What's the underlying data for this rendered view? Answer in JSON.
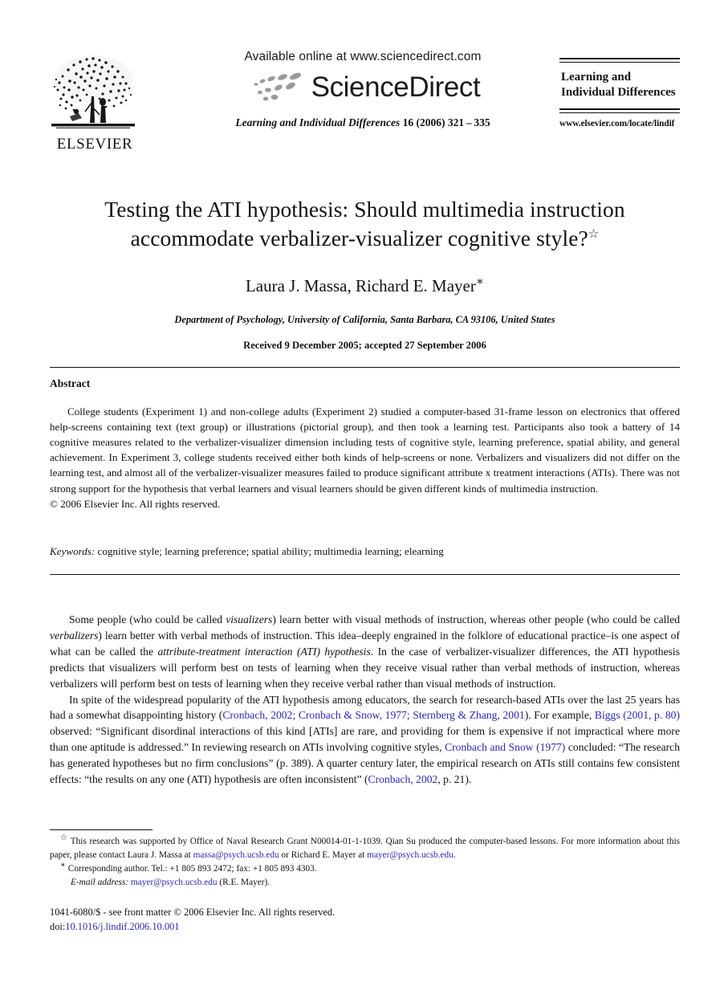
{
  "masthead": {
    "publisher_name": "ELSEVIER",
    "available_online": "Available online at www.sciencedirect.com",
    "sciencedirect_wordmark": "ScienceDirect",
    "journal_citation_italic": "Learning and Individual Differences",
    "journal_citation_rest": " 16 (2006) 321 – 335",
    "journal_logo_line1": "Learning and",
    "journal_logo_line2": "Individual Differences",
    "journal_url": "www.elsevier.com/locate/lindif"
  },
  "title": {
    "line1": "Testing the ATI hypothesis: Should multimedia instruction",
    "line2": "accommodate verbalizer-visualizer cognitive style?",
    "footnote_marker": "☆"
  },
  "authors": {
    "names": "Laura J. Massa, Richard E. Mayer",
    "corresponding_marker": "∗",
    "affiliation": "Department of Psychology, University of California, Santa Barbara, CA 93106, United States",
    "dates": "Received 9 December 2005; accepted 27 September 2006"
  },
  "abstract": {
    "heading": "Abstract",
    "paragraph": "College students (Experiment 1) and non-college adults (Experiment 2) studied a computer-based 31-frame lesson on electronics that offered help-screens containing text (text group) or illustrations (pictorial group), and then took a learning test. Participants also took a battery of 14 cognitive measures related to the verbalizer-visualizer dimension including tests of cognitive style, learning preference, spatial ability, and general achievement. In Experiment 3, college students received either both kinds of help-screens or none. Verbalizers and visualizers did not differ on the learning test, and almost all of the verbalizer-visualizer measures failed to produce significant attribute x treatment interactions (ATIs). There was not strong support for the hypothesis that verbal learners and visual learners should be given different kinds of multimedia instruction.",
    "copyright": "© 2006 Elsevier Inc. All rights reserved."
  },
  "keywords": {
    "label": "Keywords:",
    "list": " cognitive style; learning preference; spatial ability; multimedia learning; elearning"
  },
  "body": {
    "p1": {
      "s1": "Some people (who could be called ",
      "i1": "visualizers",
      "s2": ") learn better with visual methods of instruction, whereas other people (who could be called ",
      "i2": "verbalizers",
      "s3": ") learn better with verbal methods of instruction. This idea–deeply engrained in the folklore of educational practice–is one aspect of what can be called the ",
      "i3": "attribute-treatment interaction (ATI) hypothesis",
      "s4": ". In the case of verbalizer-visualizer differences, the ATI hypothesis predicts that visualizers will perform best on tests of learning when they receive visual rather than verbal methods of instruction, whereas verbalizers will perform best on tests of learning when they receive verbal rather than visual methods of instruction."
    },
    "p2": {
      "s1": "In spite of the widespread popularity of the ATI hypothesis among educators, the search for research-based ATIs over the last 25 years has had a somewhat disappointing history (",
      "c1": "Cronbach, 2002; Cronbach & Snow, 1977; Sternberg & Zhang, 2001",
      "s2": "). For example, ",
      "c2": "Biggs (2001, p. 80)",
      "s3": " observed: “Significant disordinal interactions of this kind [ATIs] are rare, and providing for them is expensive if not impractical where more than one aptitude is addressed.” In reviewing research on ATIs involving cognitive styles, ",
      "c3": "Cronbach and Snow (1977)",
      "s4": " concluded: “The research has generated hypotheses but no firm conclusions” (p. 389). A quarter century later, the empirical research on ATIs still contains few consistent effects: “the results on any one (ATI) hypothesis are often inconsistent” (",
      "c4": "Cronbach, 2002",
      "s5": ", p. 21)."
    }
  },
  "footnotes": {
    "star_marker": "☆",
    "star_text_a": "This research was supported by Office of Naval Research Grant N00014-01-1-1039. Qian Su produced the computer-based lessons. For more information about this paper, please contact Laura J. Massa at ",
    "star_email_1": "massa@psych.ucsb.edu",
    "star_text_b": " or Richard E. Mayer at ",
    "star_email_2": "mayer@psych.ucsb.edu",
    "star_text_c": ".",
    "asterisk_marker": "∗",
    "corresponding_text": "Corresponding author. Tel.: +1 805 893 2472; fax: +1 805 893 4303.",
    "email_label": "E-mail address:",
    "email_value": " mayer@psych.ucsb.edu",
    "email_suffix": " (R.E. Mayer)."
  },
  "imprint": {
    "issn_line": "1041-6080/$ - see front matter © 2006 Elsevier Inc. All rights reserved.",
    "doi_label": "doi:",
    "doi_value": "10.1016/j.lindif.2006.10.001"
  },
  "colors": {
    "link": "#2a2ab0",
    "text": "#111111",
    "sd_swoosh": "#9a9a9a"
  }
}
